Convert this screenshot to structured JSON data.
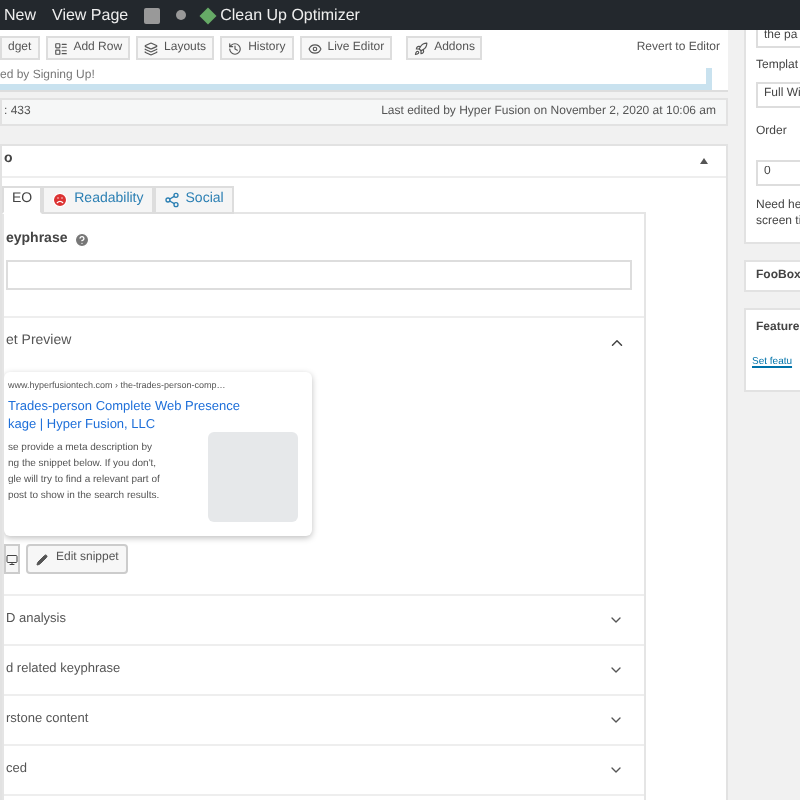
{
  "admin_bar": {
    "items": [
      "New",
      "View Page",
      "Clean Up Optimizer"
    ]
  },
  "builder_toolbar": {
    "buttons": [
      {
        "label": "dget",
        "kind": "widget"
      },
      {
        "label": "Add Row",
        "kind": "row"
      },
      {
        "label": "Layouts",
        "kind": "layouts"
      },
      {
        "label": "History",
        "kind": "history"
      },
      {
        "label": "Live Editor",
        "kind": "live"
      },
      {
        "label": "Addons",
        "kind": "addons"
      }
    ],
    "revert": "Revert to Editor",
    "notice": "ed by Signing Up!"
  },
  "status": {
    "word_count": ": 433",
    "last_edited": "Last edited by Hyper Fusion on November 2, 2020 at 10:06 am"
  },
  "seo_panel": {
    "title": "o",
    "expanded": true,
    "tabs": [
      {
        "label": "EO",
        "kind": "plain",
        "selected": true
      },
      {
        "label": "Readability",
        "kind": "face",
        "selected": false
      },
      {
        "label": "Social",
        "kind": "share",
        "selected": false
      }
    ],
    "keyphrase_label": "eyphrase",
    "snippet": {
      "title": "et Preview",
      "expanded": true,
      "url": "www.hyperfusiontech.com › the-trades-person-comp…",
      "heading": "Trades-person Complete Web Presence\nkage | Hyper Fusion, LLC",
      "description": "se provide a meta description by\nng the snippet below. If you don't,\ngle will try to find a relevant part of\npost to show in the search results.",
      "edit_button": "Edit snippet"
    },
    "sections": [
      {
        "label": "D analysis",
        "expanded": false
      },
      {
        "label": "d related keyphrase",
        "expanded": false
      },
      {
        "label": "rstone content",
        "expanded": false
      },
      {
        "label": "ced",
        "expanded": false
      }
    ]
  },
  "sidebar": {
    "parent_value": "the pa",
    "template_label": "Templat",
    "template_value": "Full Wi",
    "order_label": "Order",
    "order_value": "0",
    "help": "Need he\nscreen ti",
    "foobox": "FooBox",
    "featured": "Feature",
    "featured_link": "Set featu"
  }
}
